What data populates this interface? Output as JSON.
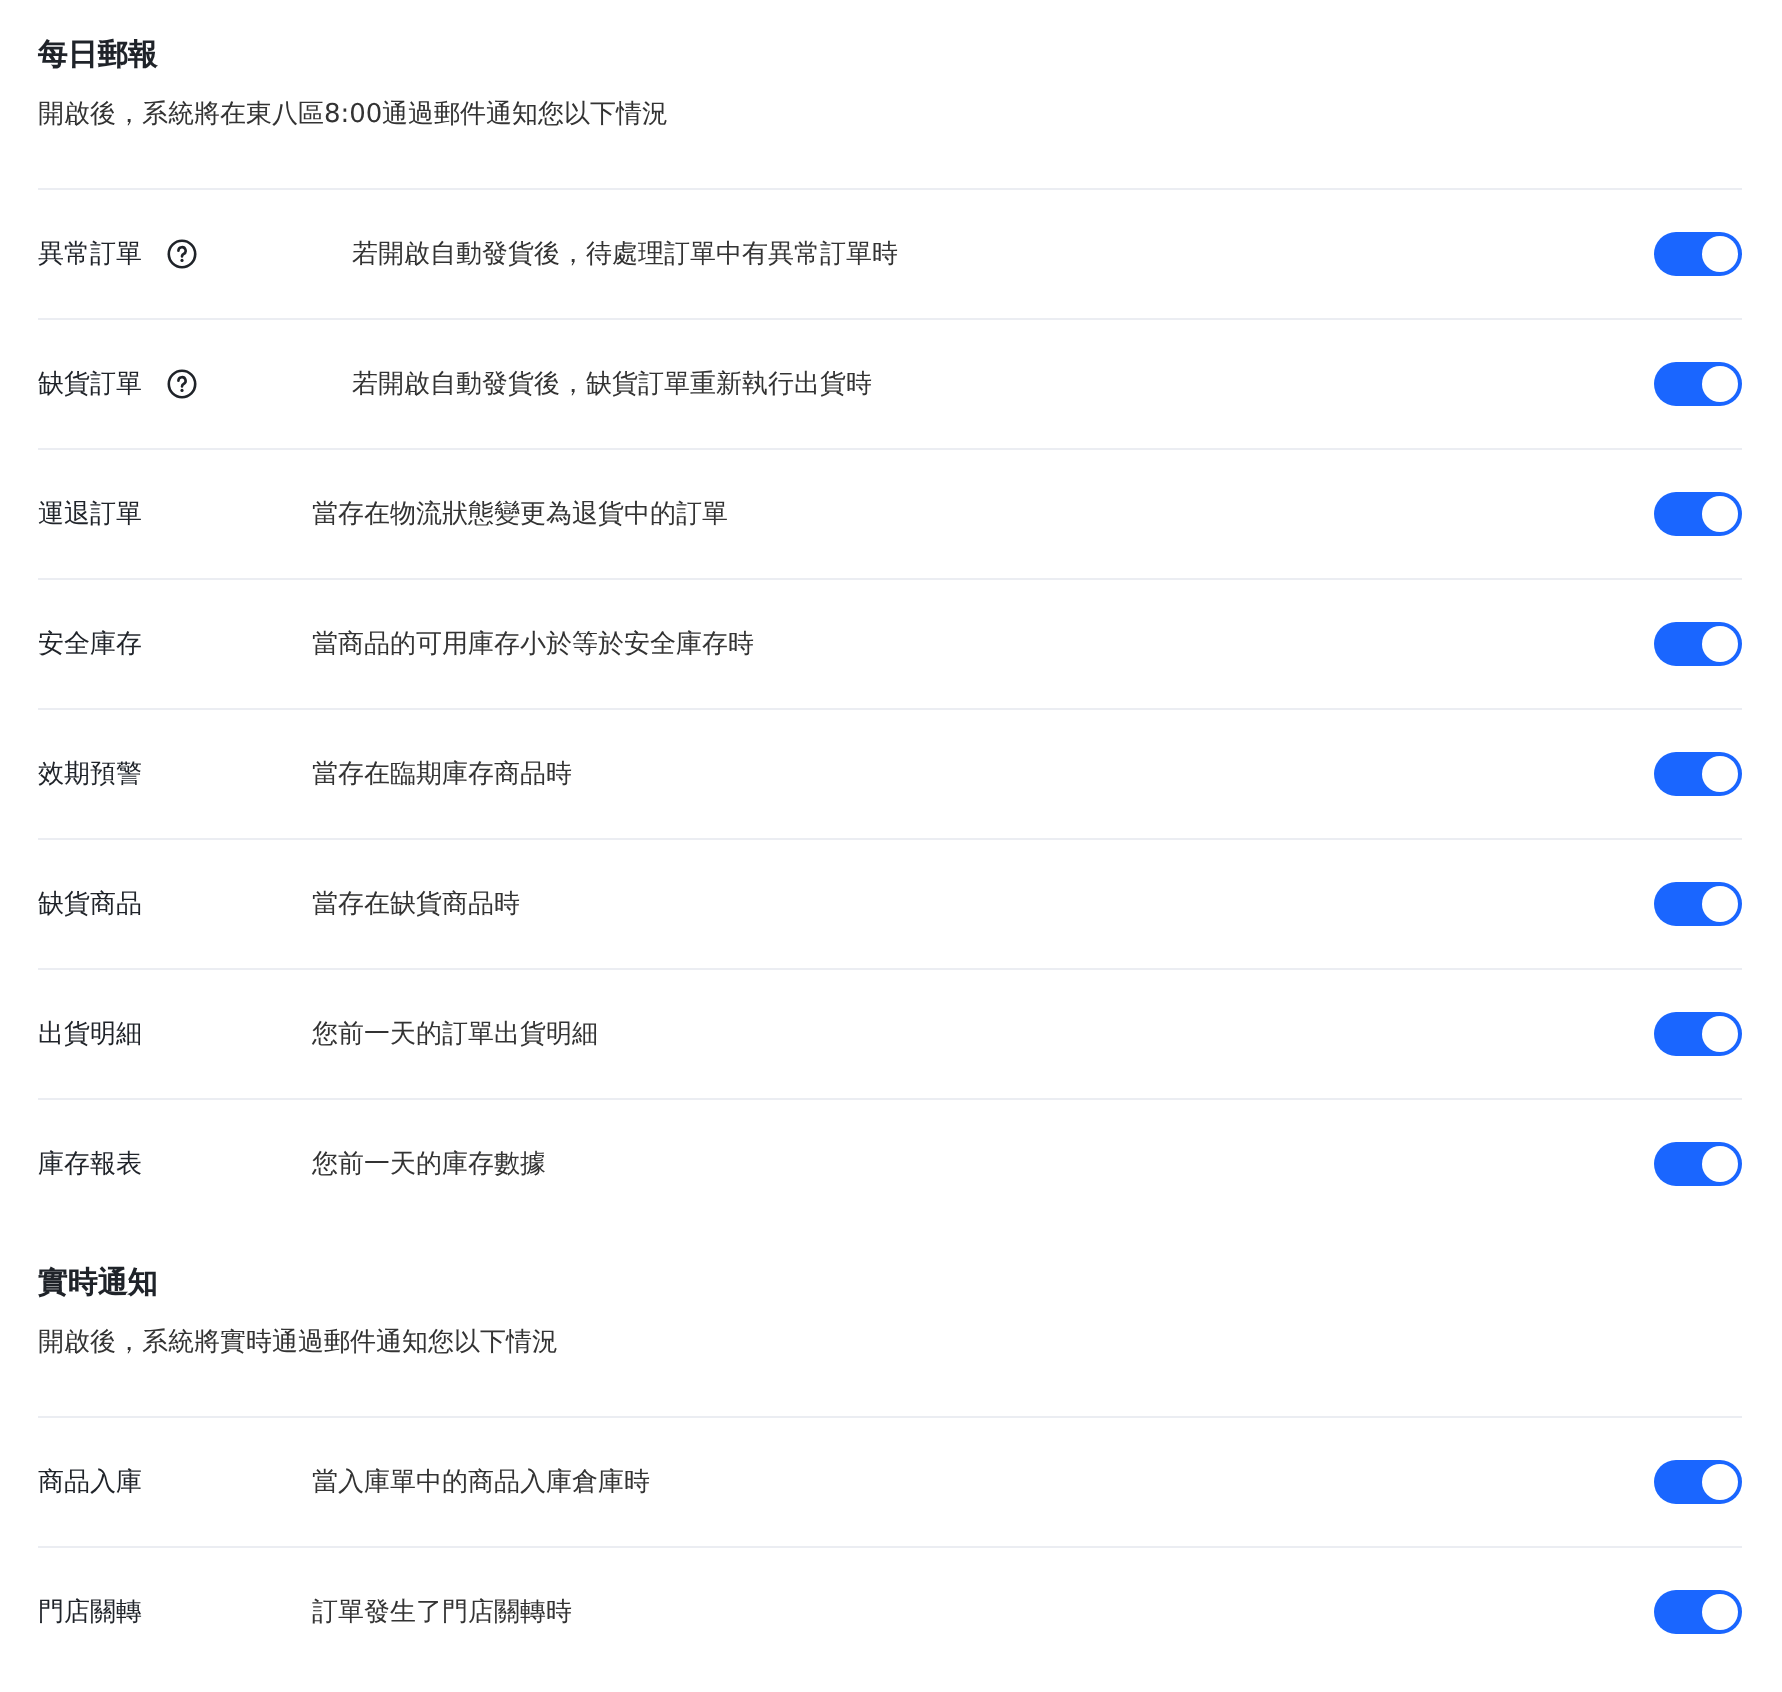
{
  "sections": [
    {
      "title": "每日郵報",
      "description": "開啟後，系統將在東八區8:00通過郵件通知您以下情況",
      "items": [
        {
          "label": "異常訂單",
          "help": true,
          "description": "若開啟自動發貨後，待處理訂單中有異常訂單時",
          "on": true
        },
        {
          "label": "缺貨訂單",
          "help": true,
          "description": "若開啟自動發貨後，缺貨訂單重新執行出貨時",
          "on": true
        },
        {
          "label": "運退訂單",
          "help": false,
          "description": "當存在物流狀態變更為退貨中的訂單",
          "on": true
        },
        {
          "label": "安全庫存",
          "help": false,
          "description": "當商品的可用庫存小於等於安全庫存時",
          "on": true
        },
        {
          "label": "效期預警",
          "help": false,
          "description": "當存在臨期庫存商品時",
          "on": true
        },
        {
          "label": "缺貨商品",
          "help": false,
          "description": "當存在缺貨商品時",
          "on": true
        },
        {
          "label": "出貨明細",
          "help": false,
          "description": "您前一天的訂單出貨明細",
          "on": true
        },
        {
          "label": "庫存報表",
          "help": false,
          "description": "您前一天的庫存數據",
          "on": true
        }
      ]
    },
    {
      "title": "實時通知",
      "description": "開啟後，系統將實時通過郵件通知您以下情況",
      "items": [
        {
          "label": "商品入庫",
          "help": false,
          "description": "當入庫單中的商品入庫倉庫時",
          "on": true
        },
        {
          "label": "門店關轉",
          "help": false,
          "description": "訂單發生了門店關轉時",
          "on": true
        }
      ]
    }
  ]
}
